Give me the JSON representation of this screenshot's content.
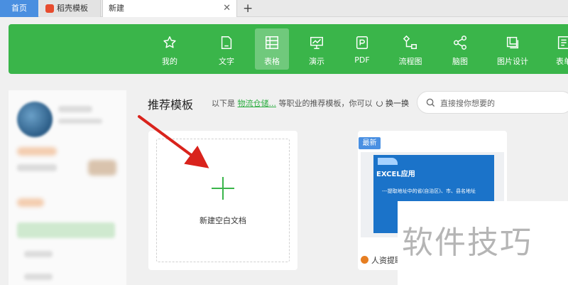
{
  "tabs": {
    "home": "首页",
    "templates": "稻壳模板",
    "new": "新建",
    "close": "✕",
    "add": "+"
  },
  "toolbar": {
    "accent": "#3ab54a",
    "items": [
      {
        "label": "我的",
        "icon": "star-icon"
      },
      {
        "label": "文字",
        "icon": "document-icon"
      },
      {
        "label": "表格",
        "icon": "spreadsheet-icon",
        "active": true
      },
      {
        "label": "演示",
        "icon": "presentation-icon"
      },
      {
        "label": "PDF",
        "icon": "pdf-icon"
      },
      {
        "label": "流程图",
        "icon": "flowchart-icon"
      },
      {
        "label": "脑图",
        "icon": "mindmap-icon"
      },
      {
        "label": "图片设计",
        "icon": "image-design-icon"
      },
      {
        "label": "表单",
        "icon": "form-icon"
      }
    ]
  },
  "main": {
    "heading": "推荐模板",
    "subtitle_prefix": "以下是",
    "subtitle_link": "物流仓储...",
    "subtitle_suffix": "等职业的推荐模板，你可以",
    "refresh_label": "换一换",
    "search_placeholder": "直接搜你想要的",
    "blank_label": "新建空白文档",
    "template": {
      "badge": "最新",
      "thumb_title": "EXCEL应用",
      "thumb_line": "---提取地址中的省(自治区)、市、县名地址",
      "name": "人资提取"
    }
  },
  "watermark": "软件技巧"
}
